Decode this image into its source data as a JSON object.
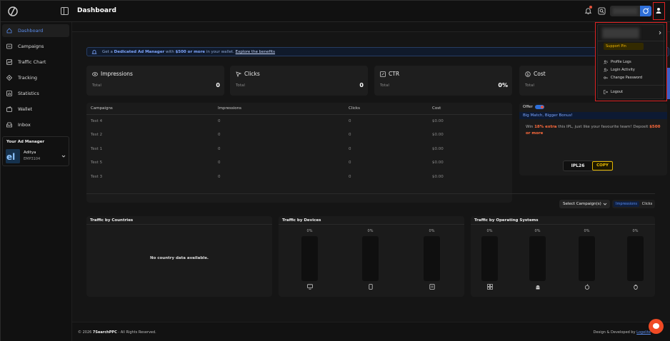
{
  "header": {
    "title": "Dashboard"
  },
  "sidebar": {
    "items": [
      {
        "label": "Dashboard",
        "icon": "home-icon",
        "active": true
      },
      {
        "label": "Campaigns",
        "icon": "campaign-icon"
      },
      {
        "label": "Traffic Chart",
        "icon": "chart-icon"
      },
      {
        "label": "Tracking",
        "icon": "tracking-icon"
      },
      {
        "label": "Statistics",
        "icon": "statistics-icon"
      },
      {
        "label": "Wallet",
        "icon": "wallet-icon"
      },
      {
        "label": "Inbox",
        "icon": "inbox-icon"
      }
    ],
    "ad_manager": {
      "title": "Your Ad Manager",
      "name": "Aditya",
      "id": "EMP3104"
    }
  },
  "banner": {
    "prefix": "Get a ",
    "bold1": "Dedicated Ad Manager",
    "middle": " with ",
    "bold2": "$500 or more",
    "suffix": " in your wallet. ",
    "link": "Explore the benefits"
  },
  "stats": [
    {
      "title": "Impressions",
      "sub": "Total",
      "value": "0",
      "icon": "eye-icon"
    },
    {
      "title": "Clicks",
      "sub": "Total",
      "value": "0",
      "icon": "cursor-icon"
    },
    {
      "title": "CTR",
      "sub": "Total",
      "value": "0%",
      "icon": "ctr-icon"
    },
    {
      "title": "Cost",
      "sub": "Total",
      "value": "",
      "icon": "dollar-icon"
    }
  ],
  "campaigns_table": {
    "columns": [
      "Campaigns",
      "Impressions",
      "Clicks",
      "Cost"
    ],
    "rows": [
      [
        "Test 4",
        "0",
        "0",
        "$0.00"
      ],
      [
        "Test 2",
        "0",
        "0",
        "$0.00"
      ],
      [
        "Test 1",
        "0",
        "0",
        "$0.00"
      ],
      [
        "Test 5",
        "0",
        "0",
        "$0.00"
      ],
      [
        "Test 3",
        "0",
        "0",
        "$0.00"
      ]
    ]
  },
  "offer": {
    "title": "Offer",
    "headline": "Big Match, Bigger Bonus!",
    "body_pre": "Win ",
    "body_hl1": "18% extra",
    "body_mid": " this IPL, just like your favourite team! Deposit ",
    "body_hl2": "$500 or more",
    "promo_code": "IPL26",
    "copy_label": "COPY"
  },
  "filters": {
    "select_label": "Select Campaign(s)",
    "toggle_impressions": "Impressions",
    "toggle_clicks": "Clicks"
  },
  "panels": {
    "countries": {
      "title": "Traffic by Countries",
      "empty": "No country data available."
    },
    "devices": {
      "title": "Traffic by Devices",
      "bars": [
        {
          "pct": "0%",
          "icon": "desktop-icon"
        },
        {
          "pct": "0%",
          "icon": "mobile-icon"
        },
        {
          "pct": "0%",
          "icon": "tablet-icon"
        }
      ]
    },
    "os": {
      "title": "Traffic by Operating Systems",
      "bars": [
        {
          "pct": "0%",
          "icon": "windows-icon"
        },
        {
          "pct": "0%",
          "icon": "android-icon"
        },
        {
          "pct": "0%",
          "icon": "apple-icon"
        },
        {
          "pct": "0%",
          "icon": "linux-icon"
        }
      ]
    }
  },
  "footer": {
    "copyright_pre": "© 2026 ",
    "brand": "7SearchPPC",
    "copyright_post": " - All Rights Reserved.",
    "design_pre": "Design & Developed by ",
    "design_link": "Logelite"
  },
  "dropdown": {
    "support_pin": "Support Pin",
    "items": [
      {
        "label": "Profile Logs",
        "icon": "profile-logs-icon"
      },
      {
        "label": "Login Activity",
        "icon": "login-activity-icon"
      },
      {
        "label": "Change Password",
        "icon": "key-icon"
      }
    ],
    "logout": "Logout"
  },
  "colors": {
    "accent": "#2f6fd8",
    "highlight": "#d22222",
    "promo": "#f0c000",
    "chat": "#f04a24"
  }
}
